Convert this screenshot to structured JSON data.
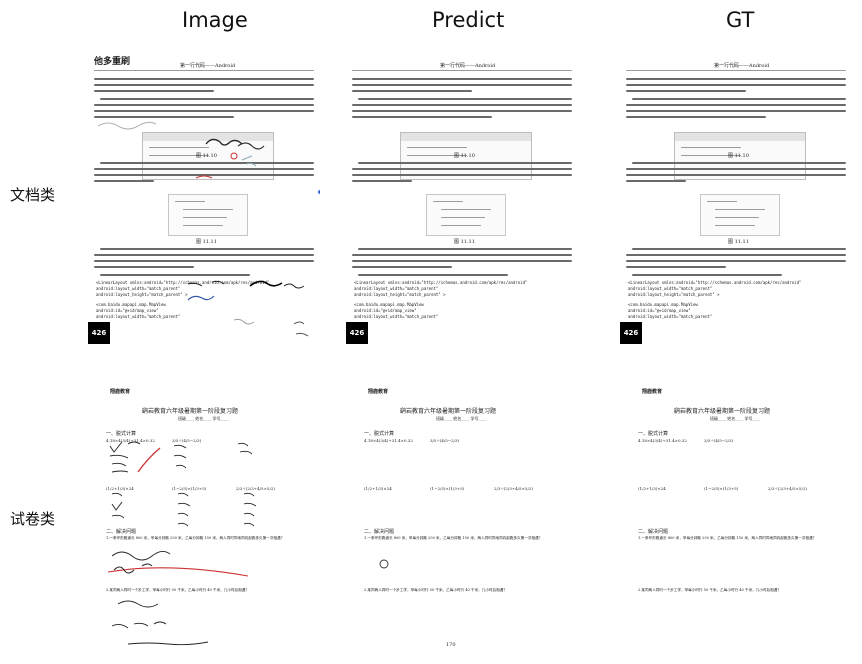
{
  "headers": [
    "Image",
    "Predict",
    "GT"
  ],
  "rows": [
    "文档类",
    "试卷类"
  ],
  "doc": {
    "logo": "他多重刷",
    "header": "第一行代码——Android",
    "fig1": "图 11.10",
    "fig2": "图 11.11",
    "page_number": "426",
    "code": [
      "<LinearLayout xmlns:android=\"http://schemas.android.com/apk/res/android\"",
      "    android:layout_width=\"match_parent\"",
      "    android:layout_height=\"match_parent\" >",
      "<com.baidu.mapapi.map.MapView",
      "    android:id=\"@+id/map_view\"",
      "    android:layout_width=\"match_parent\""
    ]
  },
  "exam": {
    "school": "翔鹿教育",
    "title": "鹞岩教育六年级暑期第一阶段复习题",
    "meta": "班级____ 姓名____ 学号____",
    "section1": "一、脱式计算",
    "section2": "二、解决问题",
    "q1": "1.一条环形跑道长 800 米，甲每分钟跑 250 米，乙每分钟跑 150 米，两人同时同地同向起跑多久第一次相遇？",
    "q2": "2.某同两人同时一个步工学，甲每小时行 50 千米，乙每小时行 40 千米，几小时后相遇？",
    "exprs": [
      "4.18×4(3/4)+31.4×0.32",
      "3/5÷(4/5−2/3)",
      "(1/2+1/3)×24",
      "(1−2/5)×(1/3+5)",
      "2/3÷(2/3+4/5×5/2)"
    ],
    "footer": "170"
  }
}
